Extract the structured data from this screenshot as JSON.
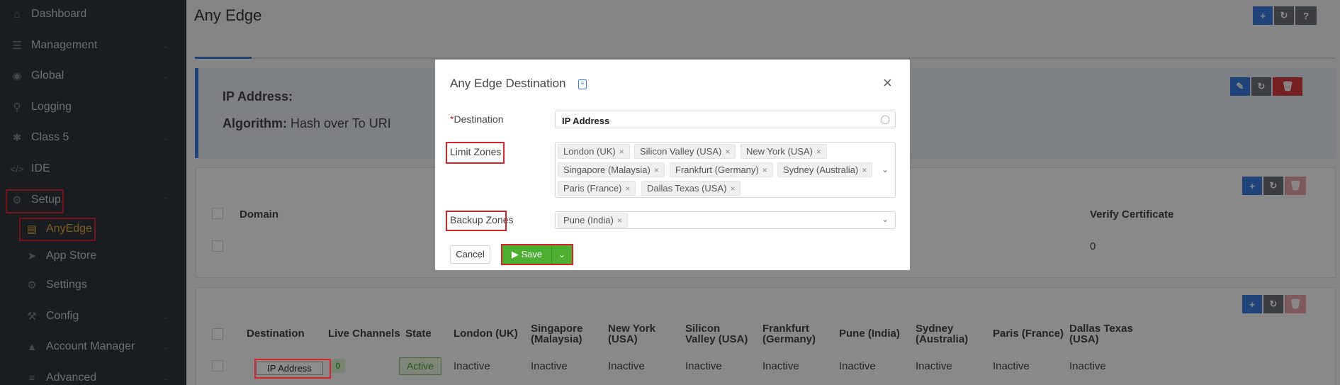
{
  "sidebar": {
    "items": [
      {
        "label": "Dashboard",
        "icon": "home-icon"
      },
      {
        "label": "Management",
        "icon": "list-icon"
      },
      {
        "label": "Global",
        "icon": "globe-icon"
      },
      {
        "label": "Logging",
        "icon": "search-icon"
      },
      {
        "label": "Class 5",
        "icon": "asterisk-icon"
      },
      {
        "label": "IDE",
        "icon": "code-icon"
      },
      {
        "label": "Setup",
        "icon": "gears-icon"
      },
      {
        "label": "AnyEdge",
        "icon": "server-icon"
      },
      {
        "label": "App Store",
        "icon": "rocket-icon"
      },
      {
        "label": "Settings",
        "icon": "gear-icon"
      },
      {
        "label": "Config",
        "icon": "wrench-icon"
      },
      {
        "label": "Account Manager",
        "icon": "user-lock-icon"
      },
      {
        "label": "Advanced",
        "icon": "sliders-icon"
      }
    ]
  },
  "page": {
    "title": "Any Edge",
    "info": {
      "ip_label": "IP Address:",
      "algorithm_label": "Algorithm:",
      "algorithm_value": "Hash over To URI"
    }
  },
  "domain_table": {
    "headers": {
      "domain": "Domain",
      "verify": "Verify Certificate"
    },
    "row": {
      "verify": "0"
    }
  },
  "dest_table": {
    "headers": [
      "Destination",
      "Live Channels",
      "State",
      "London (UK)",
      "Singapore (Malaysia)",
      "New York (USA)",
      "Silicon Valley (USA)",
      "Frankfurt (Germany)",
      "Pune (India)",
      "Sydney (Australia)",
      "Paris (France)",
      "Dallas Texas (USA)"
    ],
    "row": {
      "destination": "IP Address",
      "live_channels": "0",
      "state": "Active",
      "zones": [
        "Inactive",
        "Inactive",
        "Inactive",
        "Inactive",
        "Inactive",
        "Inactive",
        "Inactive",
        "Inactive",
        "Inactive"
      ]
    }
  },
  "modal": {
    "title": "Any Edge Destination",
    "destination_label": "Destination",
    "destination_required_mark": "*",
    "destination_value": "IP Address",
    "limit_zones_label": "Limit Zones",
    "limit_zones": [
      "London (UK)",
      "Silicon Valley (USA)",
      "New York (USA)",
      "Singapore (Malaysia)",
      "Frankfurt (Germany)",
      "Sydney (Australia)",
      "Paris (France)",
      "Dallas Texas (USA)"
    ],
    "backup_zones_label": "Backup Zones",
    "backup_zones": [
      "Pune (India)"
    ],
    "cancel_label": "Cancel",
    "save_label": "Save"
  },
  "colors": {
    "primary": "#3b7ddd",
    "success": "#4caf2f",
    "danger": "#d53b3b",
    "highlight": "#d9232b",
    "sidebar": "#2f353d"
  }
}
